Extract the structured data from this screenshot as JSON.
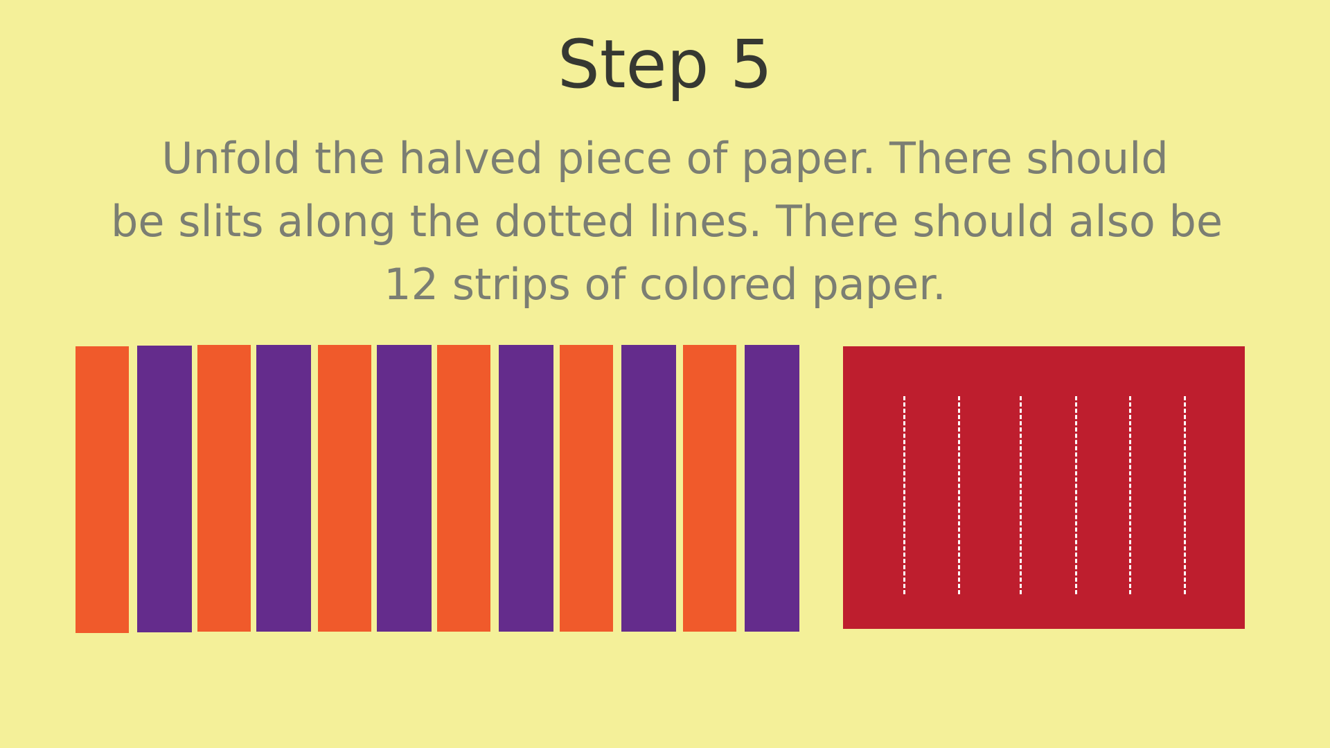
{
  "slide": {
    "title": "Step 5",
    "body_lines": [
      "Unfold the halved piece of paper. There should",
      "be slits along the dotted lines. There should also be",
      "12 strips of colored paper."
    ]
  },
  "illustration": {
    "strip_count": 12,
    "strip_colors": [
      "#f05a2b",
      "#642c8c",
      "#f05a2b",
      "#642c8c",
      "#f05a2b",
      "#642c8c",
      "#f05a2b",
      "#642c8c",
      "#f05a2b",
      "#642c8c",
      "#f05a2b",
      "#642c8c"
    ],
    "sheet_color": "#be1e2e",
    "slit_count": 6,
    "slit_color": "#ffffff",
    "background_color": "#f4f099"
  }
}
